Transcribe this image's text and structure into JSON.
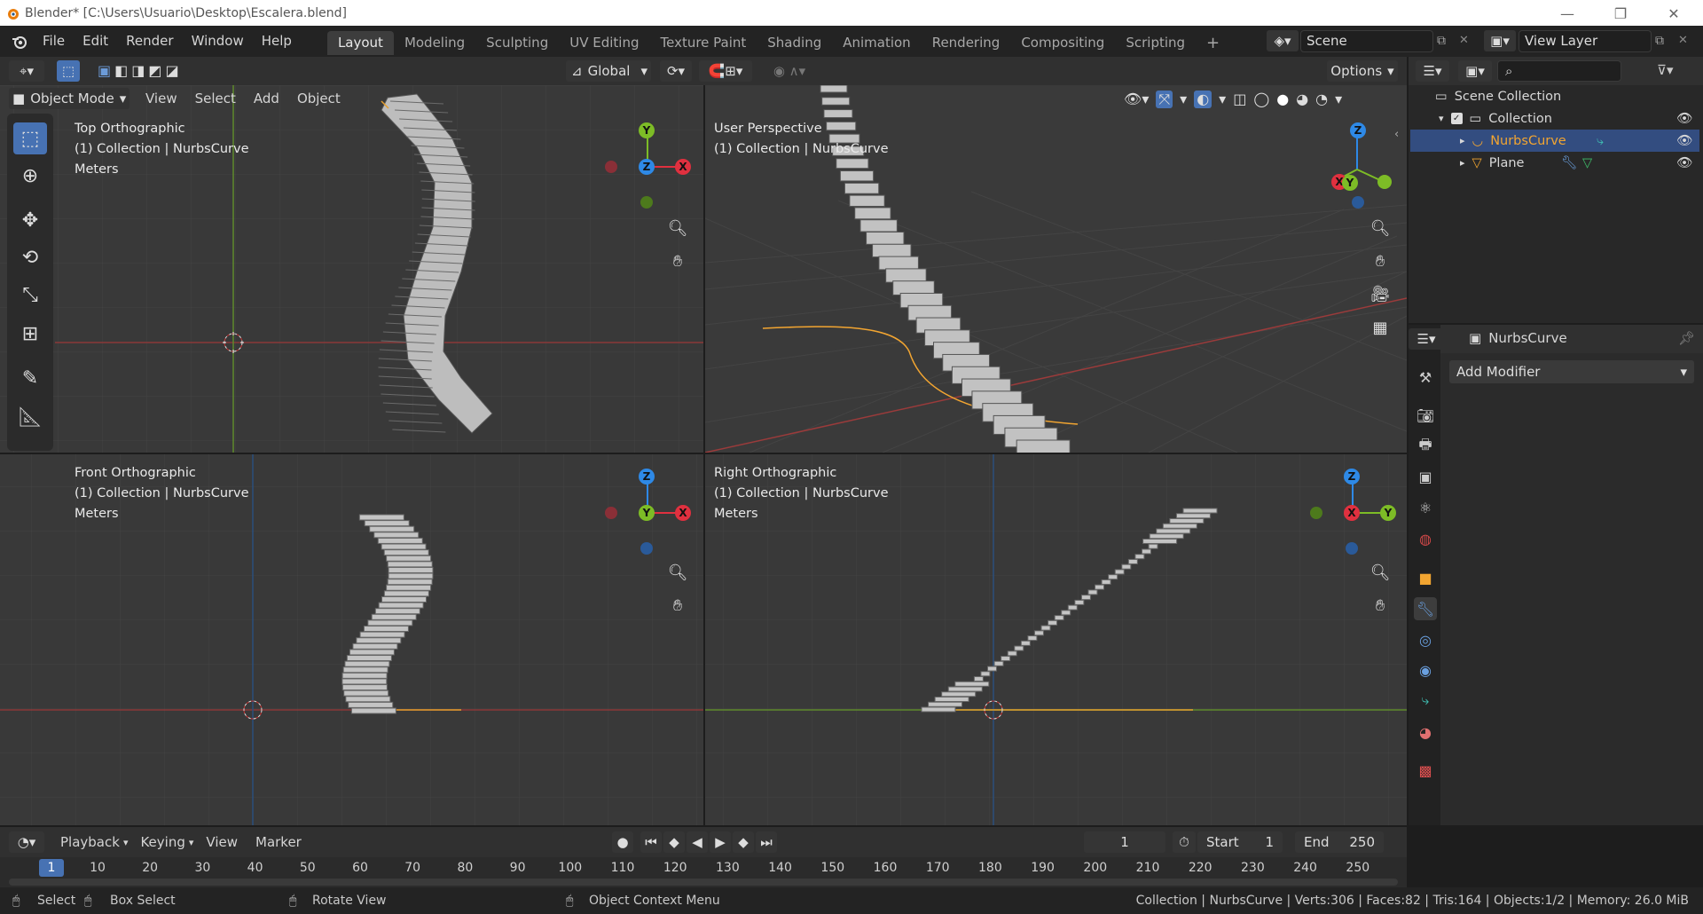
{
  "window": {
    "title": "Blender* [C:\\Users\\Usuario\\Desktop\\Escalera.blend]",
    "minimize": "—",
    "maximize": "❐",
    "close": "✕"
  },
  "menus": [
    "File",
    "Edit",
    "Render",
    "Window",
    "Help"
  ],
  "workspaces": [
    "Layout",
    "Modeling",
    "Sculpting",
    "UV Editing",
    "Texture Paint",
    "Shading",
    "Animation",
    "Rendering",
    "Compositing",
    "Scripting"
  ],
  "workspace_add": "+",
  "scene": {
    "name": "Scene",
    "view_layer": "View Layer"
  },
  "viewport_header": {
    "transform_orientation": "Global",
    "options": "Options"
  },
  "mode_menu": {
    "mode": "Object Mode",
    "items": [
      "View",
      "Select",
      "Add",
      "Object"
    ]
  },
  "viewports": {
    "top": {
      "name": "Top Orthographic",
      "collection": "(1) Collection | NurbsCurve",
      "units": "Meters"
    },
    "user": {
      "name": "User Perspective",
      "collection": "(1) Collection | NurbsCurve"
    },
    "front": {
      "name": "Front Orthographic",
      "collection": "(1) Collection | NurbsCurve",
      "units": "Meters"
    },
    "right": {
      "name": "Right Orthographic",
      "collection": "(1) Collection | NurbsCurve",
      "units": "Meters"
    }
  },
  "axes": {
    "x": "X",
    "y": "Y",
    "z": "Z"
  },
  "outliner": {
    "root": "Scene Collection",
    "collection": "Collection",
    "items": [
      "NurbsCurve",
      "Plane"
    ]
  },
  "properties": {
    "object": "NurbsCurve",
    "add_modifier": "Add Modifier"
  },
  "timeline": {
    "menus": [
      "Playback",
      "Keying",
      "View",
      "Marker"
    ],
    "current_frame": "1",
    "start_label": "Start",
    "start": "1",
    "end_label": "End",
    "end": "250",
    "ruler": [
      "1",
      "10",
      "20",
      "30",
      "40",
      "50",
      "60",
      "70",
      "80",
      "90",
      "100",
      "110",
      "120",
      "130",
      "140",
      "150",
      "160",
      "170",
      "180",
      "190",
      "200",
      "210",
      "220",
      "230",
      "240",
      "250"
    ]
  },
  "statusbar": {
    "select": "Select",
    "box_select": "Box Select",
    "rotate_view": "Rotate View",
    "context_menu": "Object Context Menu",
    "stats": "Collection | NurbsCurve | Verts:306 | Faces:82 | Tris:164 | Objects:1/2 | Memory: 26.0 MiB"
  },
  "colors": {
    "accent": "#4772b3",
    "x_axis": "#e0303f",
    "y_axis": "#7dbc26",
    "z_axis": "#2e89e6",
    "curve": "#f2a531",
    "selection": "#334d80"
  }
}
